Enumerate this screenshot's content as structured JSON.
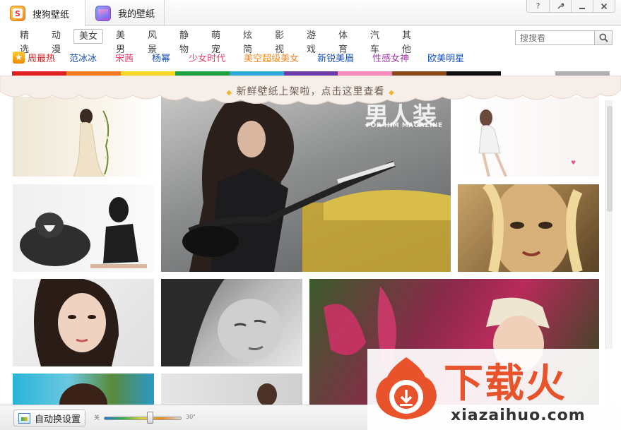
{
  "app": {
    "tabs": [
      {
        "label": "搜狗壁纸",
        "icon": "sogou-logo-icon"
      },
      {
        "label": "我的壁纸",
        "icon": "my-wallpaper-icon"
      }
    ],
    "window_controls": [
      "?",
      "wrench-icon",
      "minimize-icon",
      "close-icon"
    ]
  },
  "categories": [
    "精选",
    "动漫",
    "美女",
    "美男",
    "风景",
    "静物",
    "萌宠",
    "炫简",
    "影视",
    "游戏",
    "体育",
    "汽车",
    "其他"
  ],
  "active_category": "美女",
  "search": {
    "placeholder": "搜搜看"
  },
  "tags_row": {
    "hot_label": "周最热",
    "tags": [
      {
        "label": "范冰冰",
        "color": "#1a4fb5"
      },
      {
        "label": "宋茜",
        "color": "#e8426e"
      },
      {
        "label": "杨幂",
        "color": "#1a4fb5"
      },
      {
        "label": "少女时代",
        "color": "#e8426e"
      },
      {
        "label": "美空超级美女",
        "color": "#f08a24"
      },
      {
        "label": "新锐美眉",
        "color": "#1a4fb5"
      },
      {
        "label": "性感女神",
        "color": "#a13aa8"
      },
      {
        "label": "欧美明星",
        "color": "#1a4fb5"
      }
    ]
  },
  "color_strip": [
    "#e02020",
    "#f07820",
    "#f8d820",
    "#20a040",
    "#2aa8d8",
    "#6a3aa8",
    "#f48ab8",
    "#8a4a18",
    "#101010",
    "#ffffff",
    "#b0b0b0"
  ],
  "notice": {
    "text": "新鲜壁纸上架啦，点击这里查看"
  },
  "wallpapers": {
    "magazine_text": "FOR HIM MAGAZINE",
    "magazine_mark": "男人装"
  },
  "watermark": {
    "big": "下载火",
    "url": "xiazaihuo.com"
  },
  "bottombar": {
    "auto_label": "自动换设置",
    "slider_min": "关",
    "slider_max": "30\""
  }
}
